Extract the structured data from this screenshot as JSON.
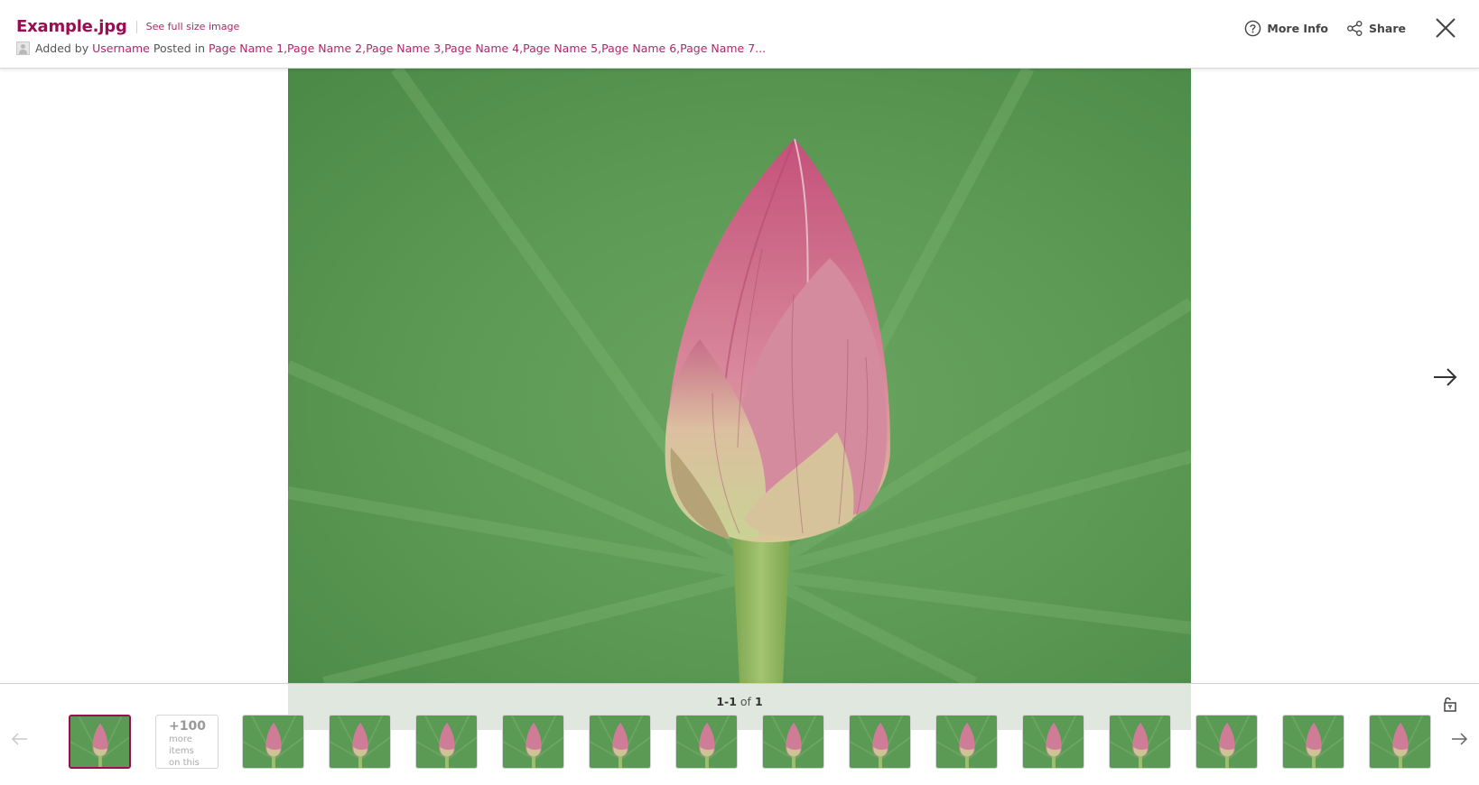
{
  "header": {
    "title": "Example.jpg",
    "full_size_link": "See full size image",
    "added_by_label": "Added by",
    "username": "Username",
    "posted_in_label": "Posted in",
    "pages": [
      "Page Name 1,",
      "Page Name 2,",
      "Page Name 3,",
      "Page Name 4,",
      "Page Name 5,",
      "Page Name 6,",
      "Page Name 7..."
    ],
    "more_info_label": "More Info",
    "share_label": "Share"
  },
  "viewer": {
    "image_alt": "Pink lotus bud on green leaf background",
    "counter": {
      "start": "1-1",
      "of_label": "of",
      "total": "1"
    }
  },
  "filmstrip": {
    "more_count": "+100",
    "more_text": "more items on this",
    "thumbnail_count": 16,
    "selected_index": 0
  },
  "colors": {
    "accent": "#9b0d52",
    "link": "#b4246a",
    "text": "#555555"
  },
  "icons": {
    "more_info": "question-circle-icon",
    "share": "share-nodes-icon",
    "close": "close-icon",
    "next": "arrow-right-icon",
    "prev": "arrow-left-icon",
    "lock": "unlock-icon",
    "avatar": "user-avatar-icon"
  }
}
